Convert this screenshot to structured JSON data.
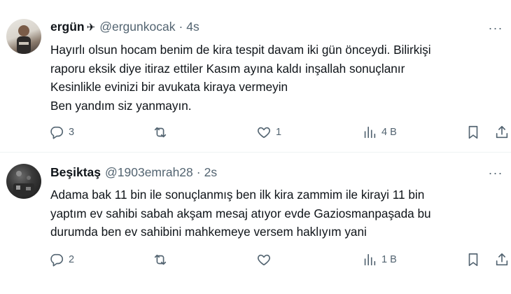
{
  "tweets": [
    {
      "name": "ergün",
      "badge": "✈",
      "handle": "@ergunkocak",
      "dot": "·",
      "time": "4s",
      "more": "···",
      "lines": [
        "Hayırlı olsun hocam benim de kira tespit davam iki gün önceydi. Bilirkişi",
        "raporu eksik diye itiraz ettiler Kasım ayına kaldı inşallah sonuçlanır",
        "Kesinlikle evinizi bir avukata kiraya vermeyin",
        "Ben yandım siz yanmayın."
      ],
      "replies": "3",
      "retweets": "",
      "likes": "1",
      "views": "4 B"
    },
    {
      "name": "Beşiktaş",
      "badge": "",
      "handle": "@1903emrah28",
      "dot": "·",
      "time": "2s",
      "more": "···",
      "lines": [
        "Adama bak 11 bin ile sonuçlanmış ben ilk kira zammim ile kirayi 11 bin",
        "yaptım ev sahibi sabah akşam mesaj atıyor evde Gaziosmanpaşada bu",
        "durumda ben ev sahibini mahkemeye versem haklıyım yani"
      ],
      "replies": "2",
      "retweets": "",
      "likes": "",
      "views": "1 B"
    }
  ],
  "icons": {
    "reply": "reply-icon",
    "retweet": "retweet-icon",
    "like": "heart-icon",
    "views": "views-icon",
    "bookmark": "bookmark-icon",
    "share": "share-icon"
  },
  "colors": {
    "text": "#0f1419",
    "secondary": "#536471",
    "divider": "#eff3f4"
  }
}
